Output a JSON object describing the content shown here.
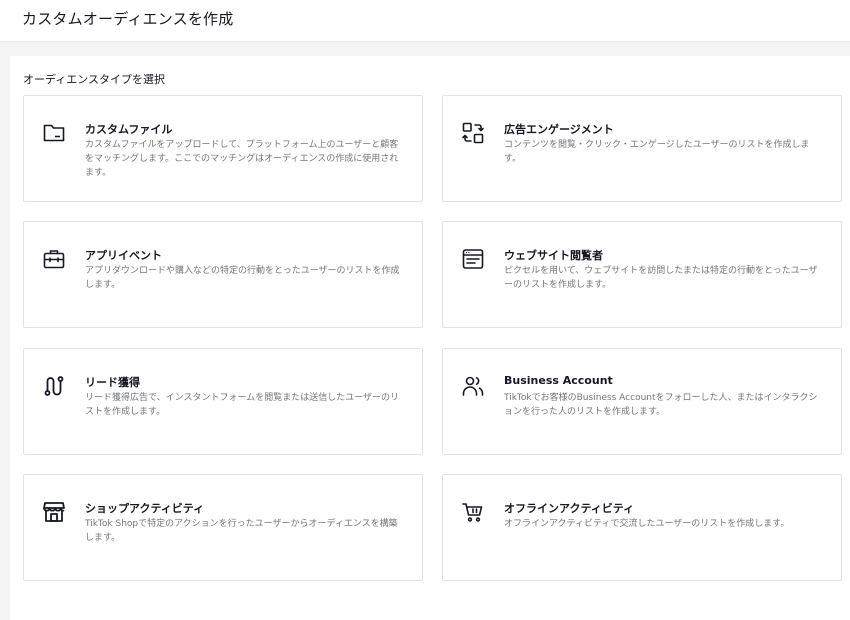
{
  "header": {
    "title": "カスタムオーディエンスを作成"
  },
  "section": {
    "title": "オーディエンスタイプを選択"
  },
  "cards": [
    {
      "title": "カスタムファイル",
      "description": "カスタムファイルをアップロードして、プラットフォーム上のユーザーと顧客をマッチングします。ここでのマッチングはオーディエンスの作成に使用されます。",
      "icon": "folder-icon"
    },
    {
      "title": "広告エンゲージメント",
      "description": "コンテンツを閲覧・クリック・エンゲージしたユーザーのリストを作成します。",
      "icon": "engagement-icon"
    },
    {
      "title": "アプリイベント",
      "description": "アプリダウンロードや購入などの特定の行動をとったユーザーのリストを作成します。",
      "icon": "briefcase-icon"
    },
    {
      "title": "ウェブサイト閲覧者",
      "description": "ピクセルを用いて、ウェブサイトを訪問したまたは特定の行動をとったユーザーのリストを作成します。",
      "icon": "browser-window-icon"
    },
    {
      "title": "リード獲得",
      "description": "リード獲得広告で、インスタントフォームを閲覧または送信したユーザーのリストを作成します。",
      "icon": "route-icon"
    },
    {
      "title": "Business Account",
      "description": "TikTokでお客様のBusiness Accountをフォローした人、またはインタラクションを行った人のリストを作成します。",
      "icon": "users-icon"
    },
    {
      "title": "ショップアクティビティ",
      "description": "TikTok Shopで特定のアクションを行ったユーザーからオーディエンスを構築します。",
      "icon": "store-icon"
    },
    {
      "title": "オフラインアクティビティ",
      "description": "オフラインアクティビティで交流したユーザーのリストを作成します。",
      "icon": "shopping-cart-icon"
    }
  ]
}
